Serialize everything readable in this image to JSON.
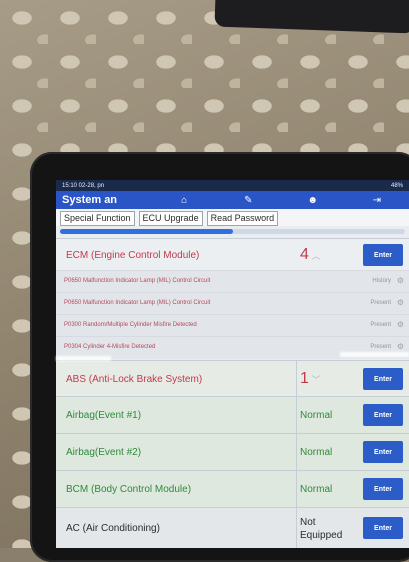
{
  "status_bar": {
    "time": "15:10 02-28, pn",
    "battery": "48%"
  },
  "header": {
    "title": "System an",
    "icons": [
      "home-icon",
      "report-icon",
      "user-icon",
      "exit-icon"
    ]
  },
  "tabs": [
    "Special Function",
    "ECU Upgrade",
    "Read Password"
  ],
  "progress": {
    "percent": 50
  },
  "systems": [
    {
      "name": "ECM (Engine Control Module)",
      "status": "4",
      "enter": "Enter"
    },
    {
      "name": "ABS (Anti-Lock Brake System)",
      "status": "1",
      "enter": "Enter"
    },
    {
      "name": "Airbag(Event #1)",
      "status": "Normal",
      "enter": "Enter"
    },
    {
      "name": "Airbag(Event #2)",
      "status": "Normal",
      "enter": "Enter"
    },
    {
      "name": "BCM (Body Control Module)",
      "status": "Normal",
      "enter": "Enter"
    },
    {
      "name": "AC (Air Conditioning)",
      "status": "Not Equipped",
      "enter": "Enter"
    }
  ],
  "dtcs": [
    {
      "description": "P0650 Malfunction Indicator Lamp (MIL) Control Circuit",
      "state": "History"
    },
    {
      "description": "P0650 Malfunction Indicator Lamp (MIL) Control Circuit",
      "state": "Present"
    },
    {
      "description": "P0300 Random/Multiple Cylinder Misfire Detected",
      "state": "Present"
    },
    {
      "description": "P0304 Cylinder 4-Misfire Detected",
      "state": "Present"
    }
  ],
  "colors": {
    "fault_text": "#c23b4a",
    "normal_text": "#2e8b3a",
    "accent": "#2b5cc8"
  }
}
